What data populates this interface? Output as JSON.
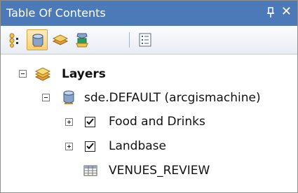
{
  "window": {
    "title": "Table Of Contents",
    "pin_icon": "pin-icon",
    "close_icon": "close-icon",
    "close_glyph": "✕"
  },
  "toolbar": {
    "buttons": [
      {
        "icon": "list-by-drawing-order-icon"
      },
      {
        "icon": "list-by-source-icon",
        "active": true
      },
      {
        "icon": "list-by-visibility-icon"
      },
      {
        "icon": "list-by-selection-icon"
      },
      {
        "icon": "options-icon"
      }
    ]
  },
  "tree": {
    "root": {
      "label": "Layers",
      "icon": "layers-icon",
      "expanded": true
    },
    "source": {
      "label": "sde.DEFAULT (arcgismachine)",
      "icon": "database-icon",
      "expanded": true
    },
    "items": [
      {
        "label": "Food and Drinks",
        "checked": true,
        "expanded": false
      },
      {
        "label": "Landbase",
        "checked": true,
        "expanded": false
      }
    ],
    "table": {
      "label": "VENUES_REVIEW",
      "icon": "table-icon"
    }
  },
  "colors": {
    "titlebar": "#4c7ab8",
    "toolbar_active": "#f7cf74"
  }
}
